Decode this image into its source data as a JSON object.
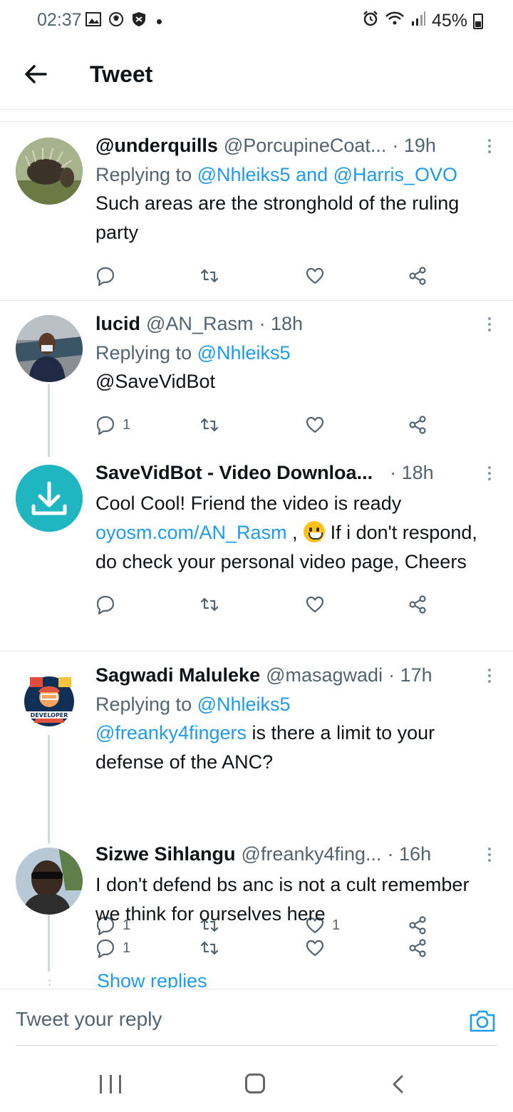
{
  "status": {
    "time": "02:37",
    "battery": "45%"
  },
  "header": {
    "title": "Tweet"
  },
  "tweets": [
    {
      "name": "@underquills",
      "handle": "@PorcupineCoat...",
      "time": "· 19h",
      "replying_prefix": "Replying to",
      "replying_to": "@Nhleiks5 and @Harris_OVO",
      "text": "Such areas are the stronghold of the ruling party",
      "reply_count": "",
      "like_count": ""
    },
    {
      "name": "lucid",
      "handle": "@AN_Rasm",
      "time": "· 18h",
      "replying_prefix": "Replying to",
      "replying_to": "@Nhleiks5",
      "text": "@SaveVidBot",
      "reply_count": "1",
      "like_count": ""
    },
    {
      "name": "SaveVidBot - Video Downloa...",
      "handle": "",
      "time": "· 18h",
      "text_part1": "Cool Cool! Friend  the video is ready",
      "link": "oyosm.com/AN_Rasm",
      "text_part2": " ,",
      "text_part3": "If i don't respond, do check your personal video page, Cheers",
      "reply_count": "",
      "like_count": ""
    },
    {
      "name": "Sagwadi Maluleke",
      "handle": "@masagwadi",
      "time": "· 17h",
      "replying_prefix": "Replying to",
      "replying_to": "@Nhleiks5",
      "mention": "@freanky4fingers",
      "text": " is there a limit to your defense of the ANC?",
      "reply_count": "1",
      "like_count": "1"
    },
    {
      "name": "Sizwe Sihlangu",
      "handle": "@freanky4fing...",
      "time": "· 16h",
      "text": "I don't defend bs anc is not a cult remember we think for ourselves here",
      "reply_count": "1",
      "like_count": ""
    }
  ],
  "show_replies": "Show replies",
  "composer": {
    "placeholder": "Tweet your reply"
  },
  "avatar_badge": "DEVELOPER",
  "colors": {
    "accent": "#1d9bf0",
    "muted": "#536471",
    "savevid": "#1fb6c1"
  }
}
